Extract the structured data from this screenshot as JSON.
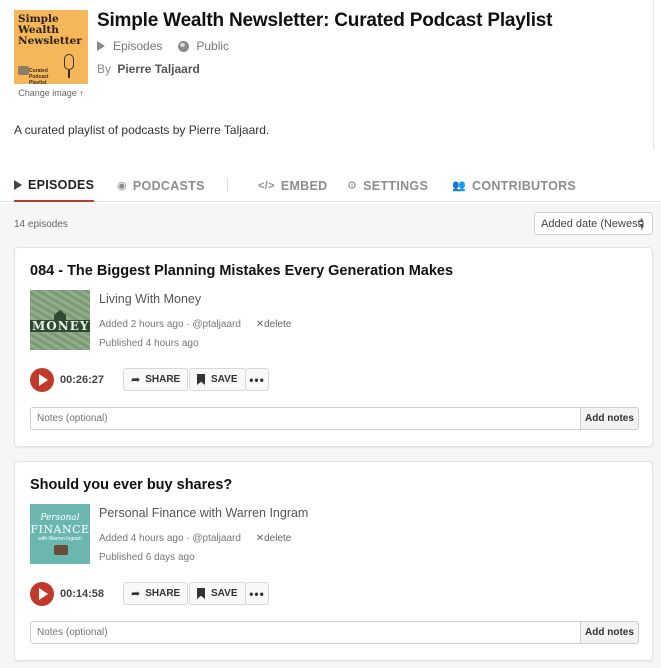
{
  "header": {
    "title": "Simple Wealth Newsletter: Curated Podcast Playlist",
    "type_label": "Episodes",
    "visibility_label": "Public",
    "by_label": "By",
    "author": "Pierre Taljaard",
    "change_image_label": "Change image",
    "cover": {
      "title_line1": "Simple",
      "title_line2": "Wealth",
      "title_line3": "Newsletter",
      "subtitle": "Curated Podcast Playlist"
    },
    "description": "A curated playlist of podcasts by Pierre Taljaard."
  },
  "tabs": [
    {
      "label": "EPISODES",
      "icon": "play-icon",
      "active": true
    },
    {
      "label": "PODCASTS",
      "icon": "podcast-icon",
      "active": false
    },
    {
      "label": "EMBED",
      "icon": "code-icon",
      "active": false
    },
    {
      "label": "SETTINGS",
      "icon": "gear-icon",
      "active": false
    },
    {
      "label": "CONTRIBUTORS",
      "icon": "users-icon",
      "active": false
    }
  ],
  "list": {
    "count_label": "14 episodes",
    "sort_value": "Added date (Newest)"
  },
  "episodes": [
    {
      "title": "084 - The Biggest Planning Mistakes Every Generation Makes",
      "podcast": "Living With Money",
      "added": "Added 2 hours ago · @ptaljaard",
      "delete_label": "delete",
      "published": "Published 4 hours ago",
      "duration": "00:26:27",
      "art": {
        "word": "MONEY"
      }
    },
    {
      "title": "Should you ever buy shares?",
      "podcast": "Personal Finance with Warren Ingram",
      "added": "Added 4 hours ago · @ptaljaard",
      "delete_label": "delete",
      "published": "Published 6 days ago",
      "duration": "00:14:58",
      "art": {
        "line1": "Personal",
        "line2": "FINANCE",
        "line3": "with Warren Ingram"
      }
    }
  ],
  "actions": {
    "share_label": "SHARE",
    "save_label": "SAVE",
    "more_label": "•••",
    "notes_placeholder": "Notes (optional)",
    "add_notes_label": "Add notes"
  },
  "colors": {
    "accent": "#c0392b",
    "cover_bg": "#f5b75a"
  }
}
